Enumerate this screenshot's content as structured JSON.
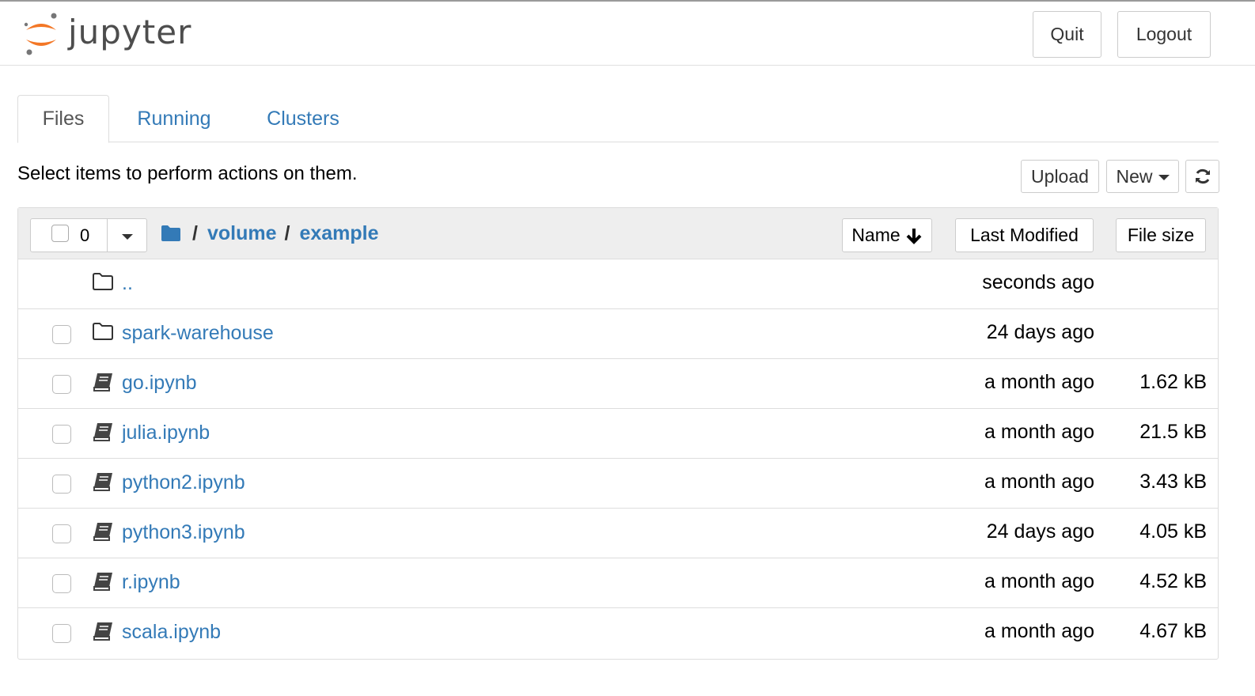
{
  "header": {
    "logo_text": "jupyter",
    "quit_label": "Quit",
    "logout_label": "Logout"
  },
  "tabs": [
    {
      "label": "Files",
      "active": true
    },
    {
      "label": "Running",
      "active": false
    },
    {
      "label": "Clusters",
      "active": false
    }
  ],
  "toolbar": {
    "hint": "Select items to perform actions on them.",
    "upload_label": "Upload",
    "new_label": "New",
    "refresh_icon": "refresh-icon"
  },
  "list_header": {
    "selected_count": "0",
    "breadcrumb": [
      "volume",
      "example"
    ],
    "sort_name_label": "Name",
    "sort_modified_label": "Last Modified",
    "sort_size_label": "File size"
  },
  "items": [
    {
      "name": "..",
      "type": "folder",
      "modified": "seconds ago",
      "size": "",
      "checkbox": false
    },
    {
      "name": "spark-warehouse",
      "type": "folder",
      "modified": "24 days ago",
      "size": "",
      "checkbox": true
    },
    {
      "name": "go.ipynb",
      "type": "notebook",
      "modified": "a month ago",
      "size": "1.62 kB",
      "checkbox": true
    },
    {
      "name": "julia.ipynb",
      "type": "notebook",
      "modified": "a month ago",
      "size": "21.5 kB",
      "checkbox": true
    },
    {
      "name": "python2.ipynb",
      "type": "notebook",
      "modified": "a month ago",
      "size": "3.43 kB",
      "checkbox": true
    },
    {
      "name": "python3.ipynb",
      "type": "notebook",
      "modified": "24 days ago",
      "size": "4.05 kB",
      "checkbox": true
    },
    {
      "name": "r.ipynb",
      "type": "notebook",
      "modified": "a month ago",
      "size": "4.52 kB",
      "checkbox": true
    },
    {
      "name": "scala.ipynb",
      "type": "notebook",
      "modified": "a month ago",
      "size": "4.67 kB",
      "checkbox": true
    }
  ],
  "colors": {
    "link": "#337ab7",
    "logo_orange": "#f37726",
    "header_bg": "#eeeeee"
  }
}
